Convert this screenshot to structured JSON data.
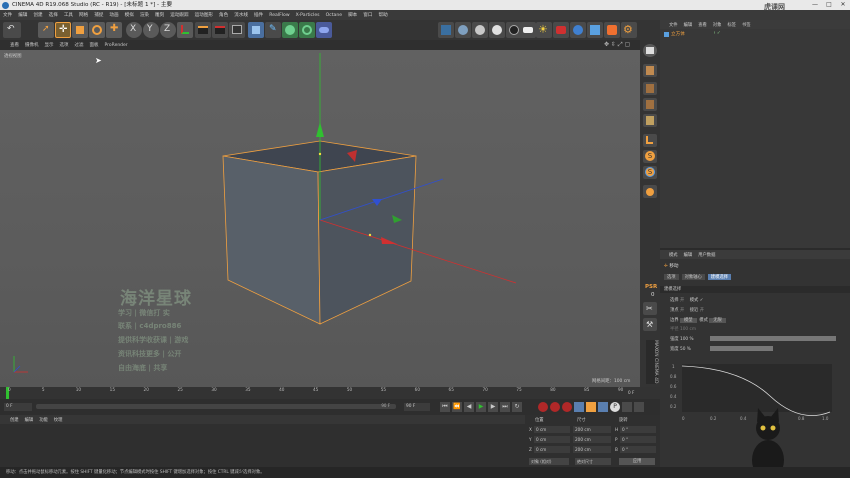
{
  "window": {
    "title": "CINEMA 4D R19.068 Studio (RC - R19) - [未标题 1 *] - 主要",
    "controls": [
      "—",
      "□",
      "✕"
    ]
  },
  "menu": [
    "文件",
    "编辑",
    "创建",
    "选择",
    "工具",
    "网格",
    "捕捉",
    "动画",
    "模拟",
    "渲染",
    "雕刻",
    "运动跟踪",
    "运动图形",
    "角色",
    "流水线",
    "插件",
    "RealFlow",
    "X-Particles",
    "Octane",
    "脚本",
    "窗口",
    "帮助"
  ],
  "viewport": {
    "menu": [
      "查看",
      "摄像机",
      "显示",
      "选项",
      "过滤",
      "面板",
      "ProRender"
    ],
    "camera_label": "透视视图",
    "grid_spacing": "网格间距：100 cm"
  },
  "watermark": {
    "title": "海洋星球",
    "lines": [
      "学习 | 微信打 实",
      "联系 | c4dpro886",
      "提供科学收获课 | 游戏",
      "资讯科技更多 | 公开",
      "自由海底 | 共享"
    ]
  },
  "timeline": {
    "ticks": [
      "0",
      "5",
      "10",
      "15",
      "20",
      "25",
      "30",
      "35",
      "40",
      "45",
      "50",
      "55",
      "60",
      "65",
      "70",
      "75",
      "80",
      "85",
      "90"
    ],
    "end_frame": "0 F"
  },
  "controls": {
    "current_frame": "0 F",
    "range_start": "0 F",
    "range_end": "90 F",
    "max_frame": "90 F"
  },
  "material_manager": {
    "menu": [
      "创建",
      "编辑",
      "功能",
      "纹理"
    ]
  },
  "coordinates": {
    "headers": [
      "位置",
      "尺寸",
      "旋转"
    ],
    "rows": [
      {
        "axis": "X",
        "pos": "0 cm",
        "size": "200 cm",
        "rot_axis": "H",
        "rot": "0 °"
      },
      {
        "axis": "Y",
        "pos": "0 cm",
        "size": "200 cm",
        "rot_axis": "P",
        "rot": "0 °"
      },
      {
        "axis": "Z",
        "pos": "0 cm",
        "size": "200 cm",
        "rot_axis": "B",
        "rot": "0 °"
      }
    ],
    "mode": "对象 (相对)",
    "size_mode": "绝对尺寸",
    "apply": "应用"
  },
  "object_manager": {
    "menu": [
      "文件",
      "编辑",
      "查看",
      "对象",
      "标签",
      "书签"
    ],
    "object_name": "立方体"
  },
  "attribute_manager": {
    "menu": [
      "模式",
      "编辑",
      "用户数据"
    ],
    "tool_name": "移动",
    "tabs": [
      "选项",
      "对象轴心",
      "建模选择"
    ],
    "section": "建模选择",
    "rows": [
      {
        "label": "选择",
        "value": "开",
        "label2": "模式",
        "value2": "✓"
      },
      {
        "label": "顶点",
        "value": "开",
        "label2": "接近",
        "value2": "开"
      },
      {
        "label": "边界",
        "value": "模型",
        "label2": "模式",
        "value2": "无限"
      }
    ],
    "radius_label": "半径",
    "radius_value": "100 cm",
    "strength_label": "强度",
    "strength_value": "100 %",
    "width_label": "宽度",
    "width_value": "50 %",
    "graph_y": [
      "1",
      "0.8",
      "0.6",
      "0.4",
      "0.2"
    ],
    "graph_x": [
      "0",
      "0.2",
      "0.4",
      "0.6",
      "0.8",
      "1.0"
    ]
  },
  "brand": {
    "top": "MAXON",
    "bottom": "CINEMA 4D"
  },
  "corner_logo": "虎课网",
  "side_badge": "PSR",
  "side_badge_value": "0",
  "status": "移动：点击并拖动鼠标移动元素。按住 SHIFT 键量化移动；节点编辑模式时按住 SHIFT 键增加选择对象；按住 CTRL 键减少选择对象。",
  "colors": {
    "accent_orange": "#f0a040",
    "axis_x": "#d03030",
    "axis_y": "#30c030",
    "axis_z": "#3050d0"
  }
}
